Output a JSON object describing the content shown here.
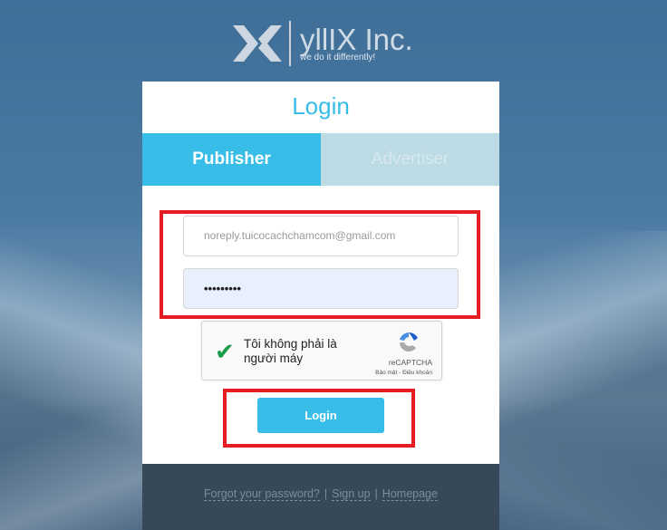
{
  "brand": {
    "name": "yllIX Inc.",
    "tagline": "we do it differently!"
  },
  "login": {
    "title": "Login",
    "tabs": [
      {
        "label": "Publisher",
        "active": true
      },
      {
        "label": "Advertiser",
        "active": false
      }
    ],
    "email_value": "noreply.tuicocachchamcom@gmail.com",
    "password_value": "•••••••••",
    "captcha": {
      "label": "Tôi không phải là người máy",
      "brand": "reCAPTCHA",
      "links": "Bảo mật - Điều khoản",
      "checked": true
    },
    "submit_label": "Login"
  },
  "footer": {
    "links": [
      "Forgot your password?",
      "Sign up",
      "Homepage"
    ],
    "separator": "|"
  },
  "colors": {
    "accent": "#38bde8",
    "highlight": "#e51c24",
    "footer": "#374959"
  }
}
